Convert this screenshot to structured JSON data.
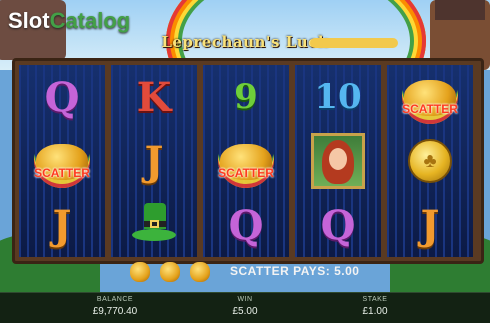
{
  "branding": {
    "logo_part1": "Slot",
    "logo_part2": "Catalog"
  },
  "game": {
    "title": "Leprechaun's Luck"
  },
  "reels": [
    [
      {
        "type": "letter",
        "value": "Q",
        "color": "purple"
      },
      {
        "type": "scatter",
        "label": "SCATTER"
      },
      {
        "type": "letter",
        "value": "J",
        "color": "orange"
      }
    ],
    [
      {
        "type": "letter",
        "value": "K",
        "color": "red"
      },
      {
        "type": "letter",
        "value": "J",
        "color": "orange"
      },
      {
        "type": "hat",
        "icon": "leprechaun-hat-icon"
      }
    ],
    [
      {
        "type": "number",
        "value": "9",
        "color": "green"
      },
      {
        "type": "scatter",
        "label": "SCATTER"
      },
      {
        "type": "letter",
        "value": "Q",
        "color": "purple"
      }
    ],
    [
      {
        "type": "number",
        "value": "10",
        "color": "blue"
      },
      {
        "type": "girl",
        "icon": "red-haired-girl-icon"
      },
      {
        "type": "letter",
        "value": "Q",
        "color": "purple"
      }
    ],
    [
      {
        "type": "scatter",
        "label": "SCATTER"
      },
      {
        "type": "coin",
        "icon": "gold-clover-coin-icon"
      },
      {
        "type": "letter",
        "value": "J",
        "color": "orange"
      }
    ]
  ],
  "status": {
    "scatter_pays": "SCATTER PAYS: 5.00",
    "pot_icons": 3
  },
  "bottom_bar": {
    "balance_label": "BALANCE",
    "balance_value": "£9,770.40",
    "win_label": "WIN",
    "win_value": "£5.00",
    "stake_label": "STAKE",
    "stake_value": "£1.00"
  }
}
